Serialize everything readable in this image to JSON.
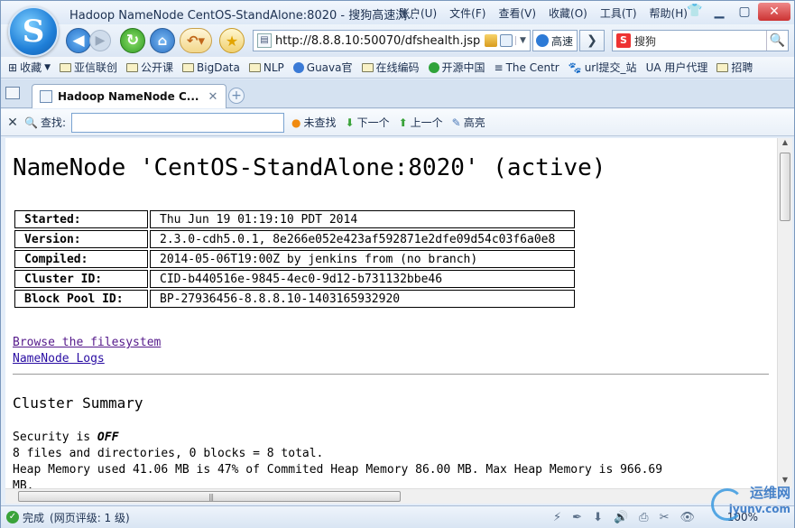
{
  "window": {
    "title": "Hadoop NameNode CentOS-StandAlone:8020 - 搜狗高速浏...",
    "menu": [
      "账户(U)",
      "文件(F)",
      "查看(V)",
      "收藏(O)",
      "工具(T)",
      "帮助(H)"
    ],
    "logo_letter": "S"
  },
  "nav": {
    "url": "http://8.8.8.10:50070/dfshealth.jsp",
    "speed_label": "高速",
    "search_placeholder": "搜狗"
  },
  "bookmarks": [
    "收藏",
    "亚信联创",
    "公开课",
    "BigData",
    "NLP",
    "Guava官",
    "在线编码",
    "开源中国",
    "The Centr",
    "url提交_站",
    "UA 用户代理",
    "招聘"
  ],
  "tab": {
    "title": "Hadoop NameNode C..."
  },
  "findbar": {
    "label": "查找:",
    "value": "",
    "not_found": "未查找",
    "next": "下一个",
    "prev": "上一个",
    "highlight": "高亮"
  },
  "page": {
    "heading": "NameNode 'CentOS-StandAlone:8020' (active)",
    "info": [
      {
        "key": "Started:",
        "value": "Thu Jun 19 01:19:10 PDT 2014"
      },
      {
        "key": "Version:",
        "value": "2.3.0-cdh5.0.1, 8e266e052e423af592871e2dfe09d54c03f6a0e8"
      },
      {
        "key": "Compiled:",
        "value": "2014-05-06T19:00Z by jenkins from (no branch)"
      },
      {
        "key": "Cluster ID:",
        "value": "CID-b440516e-9845-4ec0-9d12-b731132bbe46"
      },
      {
        "key": "Block Pool ID:",
        "value": "BP-27936456-8.8.8.10-1403165932920"
      }
    ],
    "links": [
      "Browse the filesystem",
      "NameNode Logs"
    ],
    "summary_title": "Cluster Summary",
    "security_prefix": "Security is ",
    "security_value": "OFF",
    "files_line": "8 files and directories, 0 blocks = 8 total.",
    "heap_line": "Heap Memory used 41.06 MB is 47% of Commited Heap Memory 86.00 MB. Max Heap Memory is 966.69",
    "heap_line_wrap": "MB."
  },
  "status": {
    "done": "完成",
    "rating": "(网页评级: 1 级)",
    "zoom": "100%"
  },
  "watermark": {
    "line1": "运维网",
    "line2": "iyunv.com"
  }
}
